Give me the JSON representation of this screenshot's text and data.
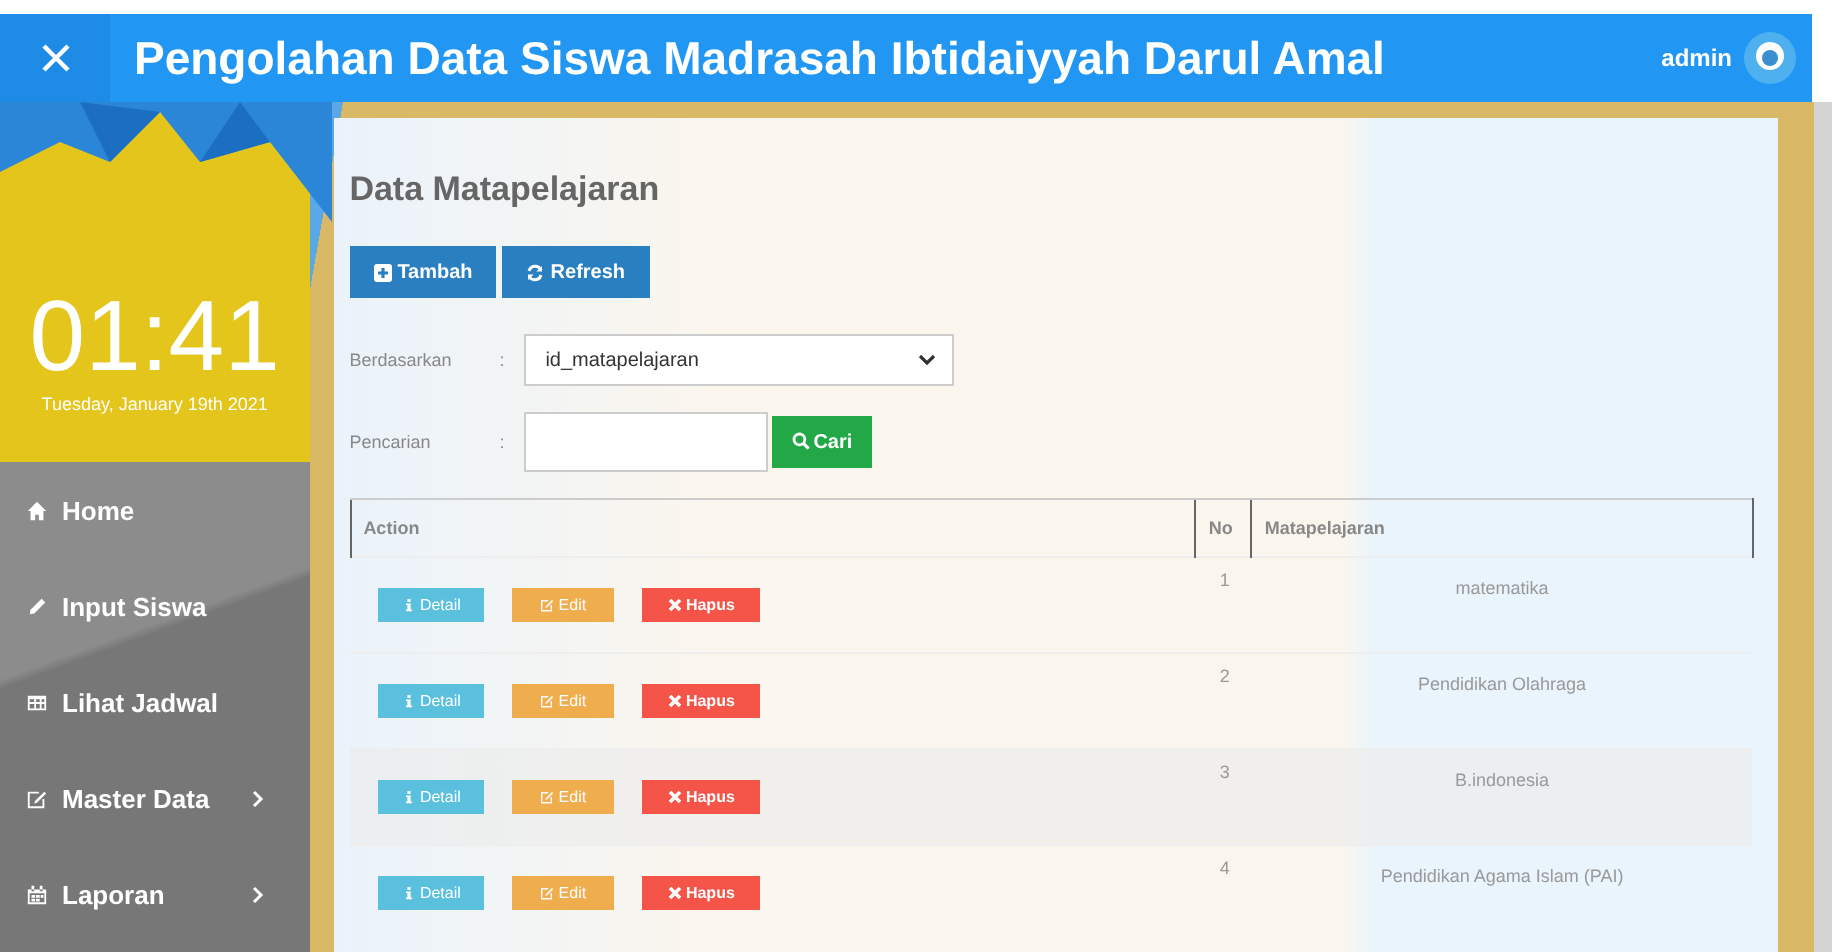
{
  "header": {
    "title": "Pengolahan Data Siswa Madrasah Ibtidaiyyah Darul Amal",
    "user": "admin"
  },
  "clock": {
    "time": "01:41",
    "date": "Tuesday, January 19th 2021"
  },
  "sidebar": {
    "items": [
      {
        "label": "Home",
        "has_submenu": false
      },
      {
        "label": "Input Siswa",
        "has_submenu": false
      },
      {
        "label": "Lihat Jadwal",
        "has_submenu": false
      },
      {
        "label": "Master Data",
        "has_submenu": true
      },
      {
        "label": "Laporan",
        "has_submenu": true
      }
    ]
  },
  "page": {
    "title": "Data Matapelajaran",
    "buttons": [
      {
        "label": "Tambah",
        "kind": "add"
      },
      {
        "label": "Refresh",
        "kind": "refresh"
      }
    ],
    "filter": {
      "label": "Berdasarkan",
      "separator": ":",
      "value": "id_matapelajaran"
    },
    "search": {
      "label": "Pencarian",
      "separator": ":",
      "button": "Cari"
    }
  },
  "table": {
    "columns": [
      "Action",
      "No",
      "Matapelajaran"
    ],
    "rows": [
      {
        "no": "1",
        "name": "matematika",
        "actions": [
          {
            "label": "Detail",
            "kind": "info"
          },
          {
            "label": "Edit",
            "kind": "edit"
          },
          {
            "label": "Hapus",
            "kind": "delete"
          }
        ]
      },
      {
        "no": "2",
        "name": "Pendidikan Olahraga",
        "actions": [
          {
            "label": "Detail",
            "kind": "info"
          },
          {
            "label": "Edit",
            "kind": "edit"
          },
          {
            "label": "Hapus",
            "kind": "delete"
          }
        ]
      },
      {
        "no": "3",
        "name": "B.indonesia",
        "actions": [
          {
            "label": "Detail",
            "kind": "info"
          },
          {
            "label": "Edit",
            "kind": "edit"
          },
          {
            "label": "Hapus",
            "kind": "delete"
          }
        ]
      },
      {
        "no": "4",
        "name": "Pendidikan Agama Islam (PAI)",
        "actions": [
          {
            "label": "Detail",
            "kind": "info"
          },
          {
            "label": "Edit",
            "kind": "edit"
          },
          {
            "label": "Hapus",
            "kind": "delete"
          }
        ]
      }
    ]
  }
}
